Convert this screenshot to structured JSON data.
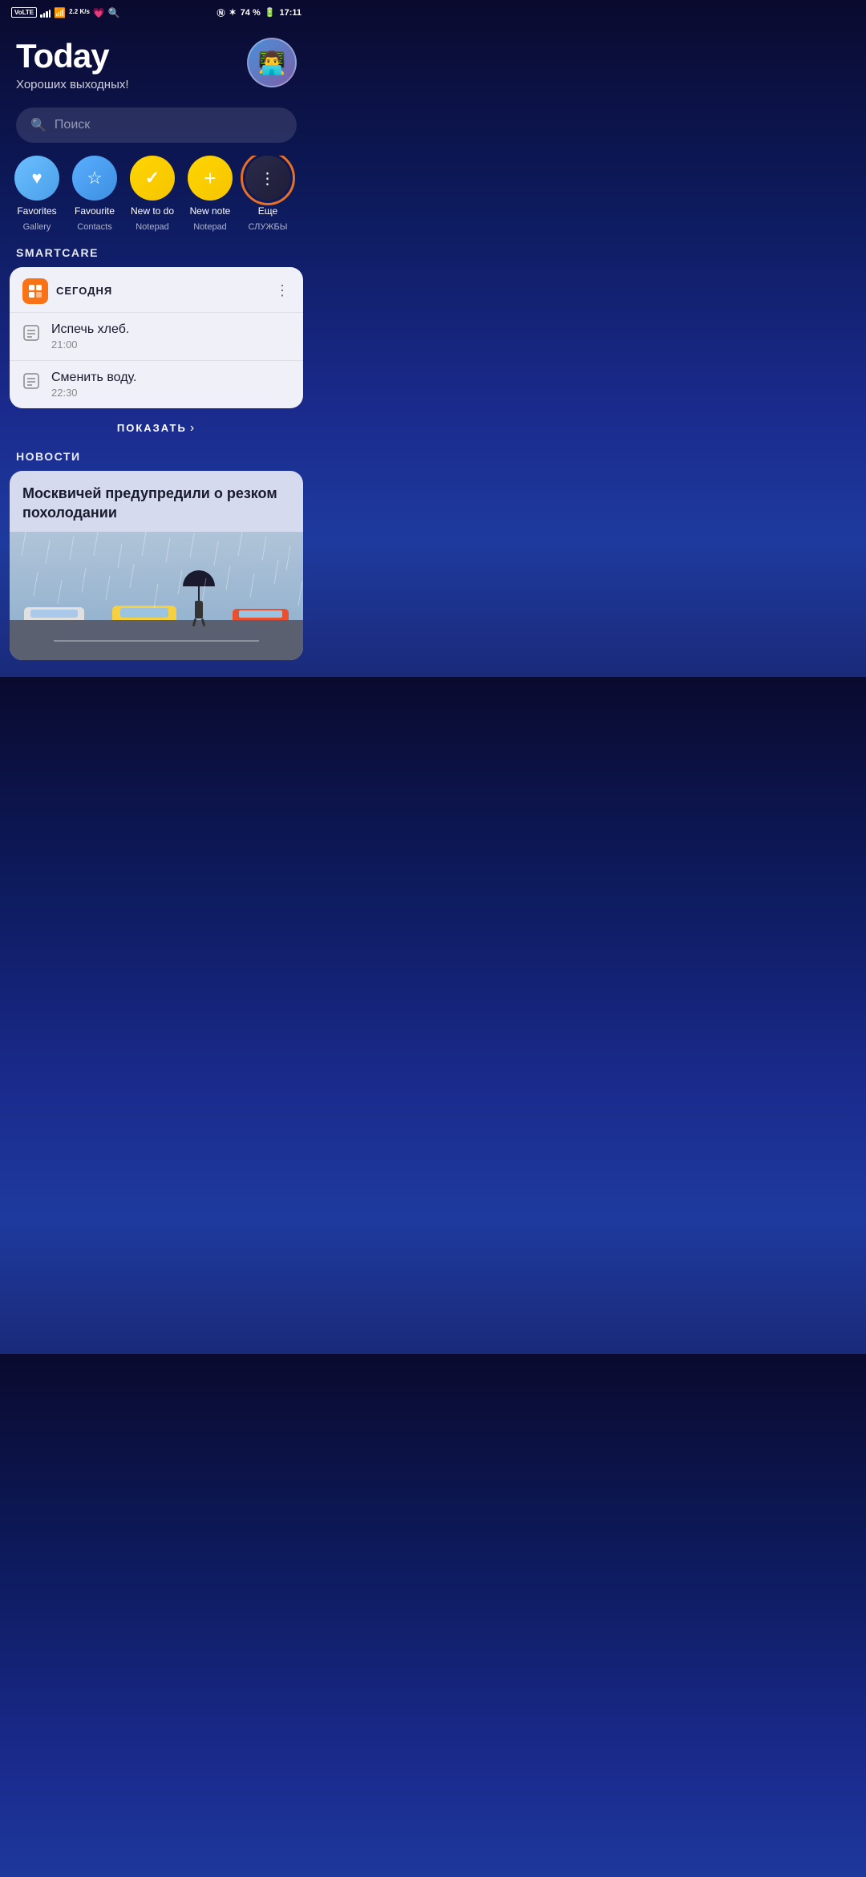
{
  "statusBar": {
    "volte": "VoLTE",
    "network": "2.2\nK/s",
    "nfc": "NFC",
    "bluetooth": "BT",
    "battery": "74 %",
    "time": "17:11"
  },
  "header": {
    "title": "Today",
    "subtitle": "Хороших выходных!",
    "avatarEmoji": "👨‍💻"
  },
  "search": {
    "placeholder": "Поиск"
  },
  "quickActions": [
    {
      "id": "favorites",
      "icon": "♥",
      "label": "Favorites",
      "sublabel": "Gallery",
      "colorClass": "circle-blue-heart"
    },
    {
      "id": "favourite-contacts",
      "icon": "☆",
      "label": "Favourite",
      "sublabel": "Contacts",
      "colorClass": "circle-blue-star"
    },
    {
      "id": "new-todo",
      "icon": "✓",
      "label": "New to do",
      "sublabel": "Notepad",
      "colorClass": "circle-yellow-check"
    },
    {
      "id": "new-note",
      "icon": "+",
      "label": "New note",
      "sublabel": "Notepad",
      "colorClass": "circle-yellow-plus"
    },
    {
      "id": "more",
      "icon": "⋮",
      "label": "Еще",
      "sublabel": "СЛУЖБЫ",
      "colorClass": "circle-dark-more",
      "hasRing": true
    }
  ],
  "smartcare": {
    "sectionTitle": "SMARTCARE",
    "headerTitle": "СЕГОДНЯ",
    "icon": "📋",
    "tasks": [
      {
        "name": "Испечь хлеб.",
        "time": "21:00"
      },
      {
        "name": "Сменить воду.",
        "time": "22:30"
      }
    ],
    "showMoreLabel": "ПОКАЗАТЬ",
    "showMoreArrow": "›"
  },
  "news": {
    "sectionTitle": "НОВОСТИ",
    "headline": "Москвичей предупредили о резком похолодании"
  }
}
